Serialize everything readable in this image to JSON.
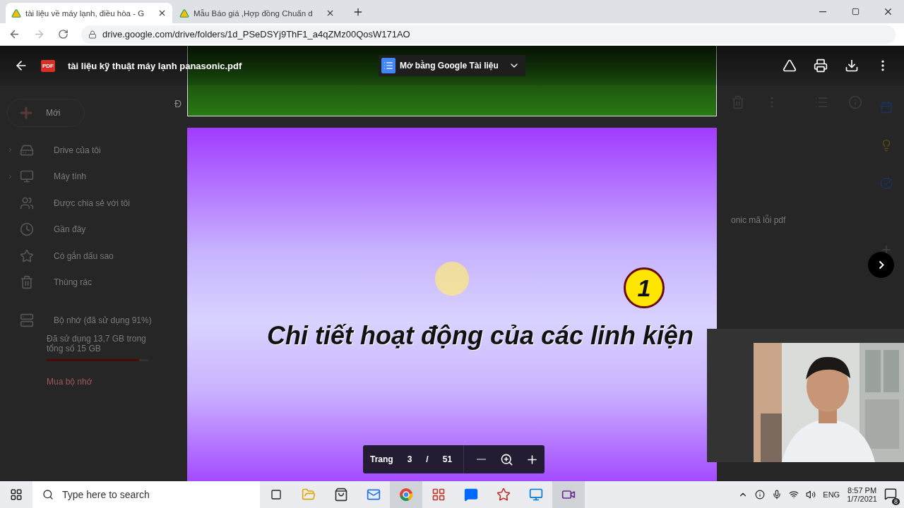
{
  "browser": {
    "tabs": [
      {
        "title": "tài liệu về máy lạnh, điều hòa - G",
        "selected": true
      },
      {
        "title": "Mẫu Báo giá ,Hợp đồng Chuẩn d",
        "selected": false
      }
    ],
    "url": "drive.google.com/drive/folders/1d_PSeDSYj9ThF1_a4qZMz00QosW171AO"
  },
  "drive": {
    "new_button": "Mới",
    "header_fragment": "Đ",
    "sidebar": [
      {
        "label": "Drive của tôi",
        "expandable": true
      },
      {
        "label": "Máy tính",
        "expandable": true
      },
      {
        "label": "Được chia sẻ với tôi",
        "expandable": false
      },
      {
        "label": "Gần đây",
        "expandable": false
      },
      {
        "label": "Có gắn dấu sao",
        "expandable": false
      },
      {
        "label": "Thùng rác",
        "expandable": false
      }
    ],
    "storage": {
      "label": "Bộ nhớ (đã sử dụng 91%)",
      "usage": "Đã sử dụng 13,7 GB trong tổng số 15 GB",
      "level": 0.91
    },
    "buy_storage": "Mua bộ nhớ",
    "file_fragment": "onic mã lỗi pdf"
  },
  "viewer": {
    "file_badge": "PDF",
    "file_name": "tài liệu kỹ thuật máy lạnh panasonic.pdf",
    "open_with": "Mở bằng Google Tài liệu",
    "slide": {
      "number": "1",
      "title": "Chi tiết hoạt động của các linh kiện"
    },
    "page_bar": {
      "label": "Trang",
      "current": "3",
      "separator": "/",
      "total": "51"
    }
  },
  "taskbar": {
    "search_placeholder": "Type here to search",
    "language": "ENG",
    "time": "8:57 PM",
    "date": "1/7/2021",
    "notifications": "8"
  }
}
